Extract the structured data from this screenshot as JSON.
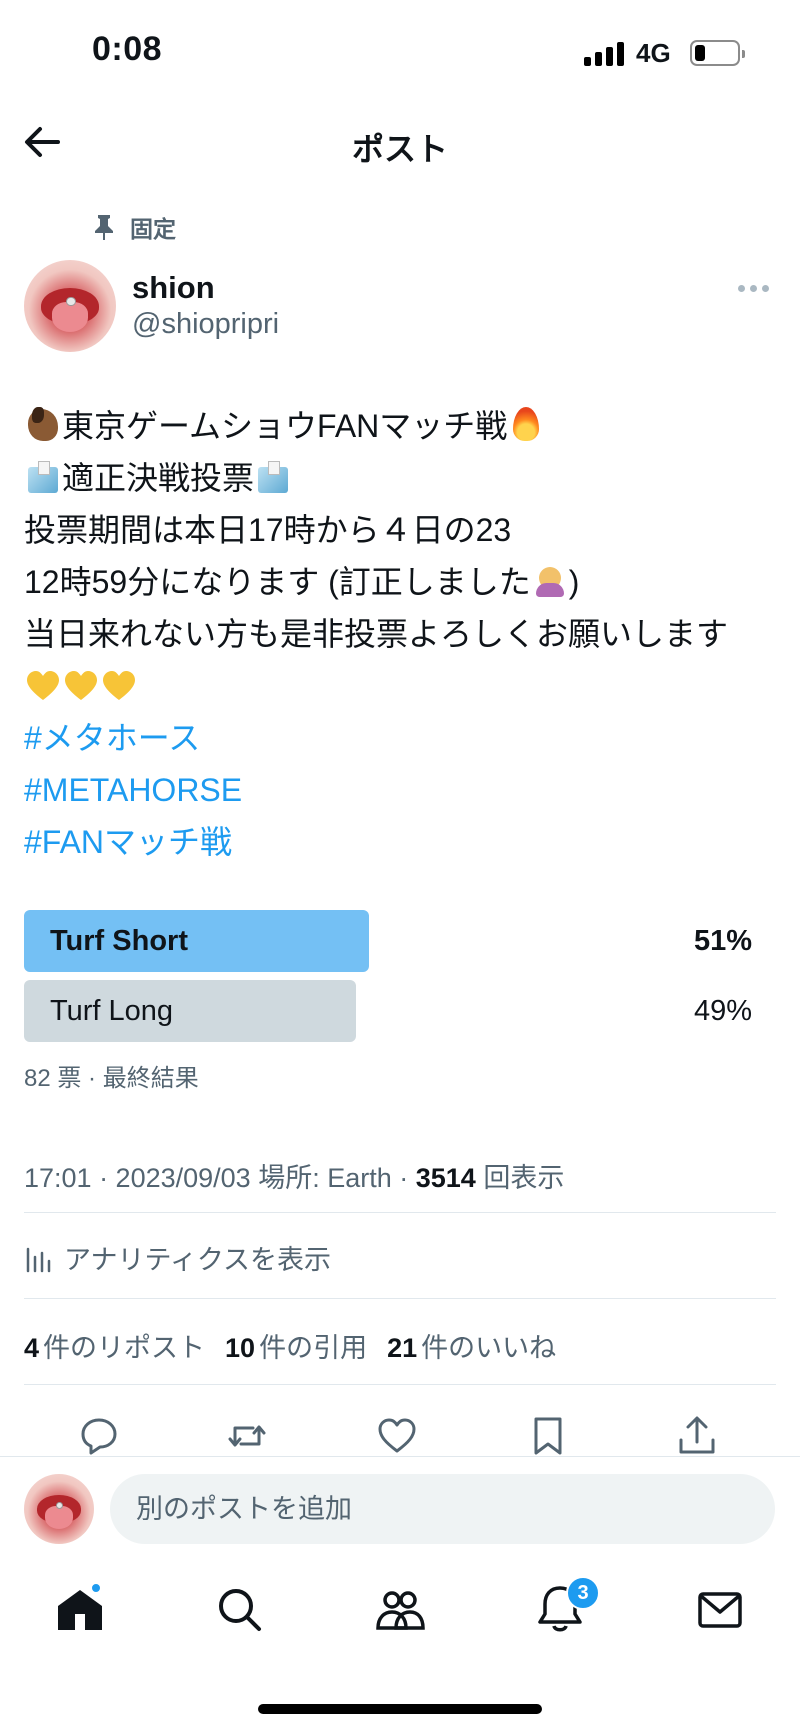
{
  "status": {
    "time": "0:08",
    "network": "4G",
    "battery_level": 0.25
  },
  "header": {
    "title": "ポスト"
  },
  "post": {
    "pinned_label": "固定",
    "author": {
      "name": "shion",
      "handle": "@shiopripri"
    },
    "text_lines": {
      "l1": "東京ゲームショウFANマッチ戦",
      "l2": "適正決戦投票",
      "l3": "投票期間は本日17時から４日の23",
      "l4a": "12時59分になります (訂正しました",
      "l4b": ")",
      "l5": "当日来れない方も是非投票よろしくお願いします"
    },
    "hashtags": [
      "#メタホース",
      "#METAHORSE",
      "#FANマッチ戦"
    ],
    "emoji": [
      "horse",
      "fire",
      "ballot-box",
      "ballot-box",
      "person-bowing",
      "yellow-heart",
      "yellow-heart",
      "yellow-heart"
    ],
    "poll": {
      "options": [
        {
          "label": "Turf Short",
          "percent": "51%",
          "fraction": 0.51,
          "winner": true
        },
        {
          "label": "Turf Long",
          "percent": "49%",
          "fraction": 0.49,
          "winner": false
        }
      ],
      "meta": "82 票 · 最終結果"
    },
    "timestamp": "17:01 · 2023/09/03 場所: Earth · ",
    "views_count": "3514",
    "views_label": " 回表示",
    "analytics_label": "アナリティクスを表示",
    "stats": {
      "reposts_count": "4",
      "reposts_label": "件のリポスト",
      "quotes_count": "10",
      "quotes_label": "件の引用",
      "likes_count": "21",
      "likes_label": "件のいいね"
    }
  },
  "reply": {
    "placeholder": "別のポストを追加"
  },
  "tabbar": {
    "notifications_badge": "3"
  },
  "colors": {
    "accent": "#1d9bf0",
    "poll_winner": "#74c0f4",
    "poll_other": "#cfd9de",
    "secondary_text": "#536471"
  }
}
